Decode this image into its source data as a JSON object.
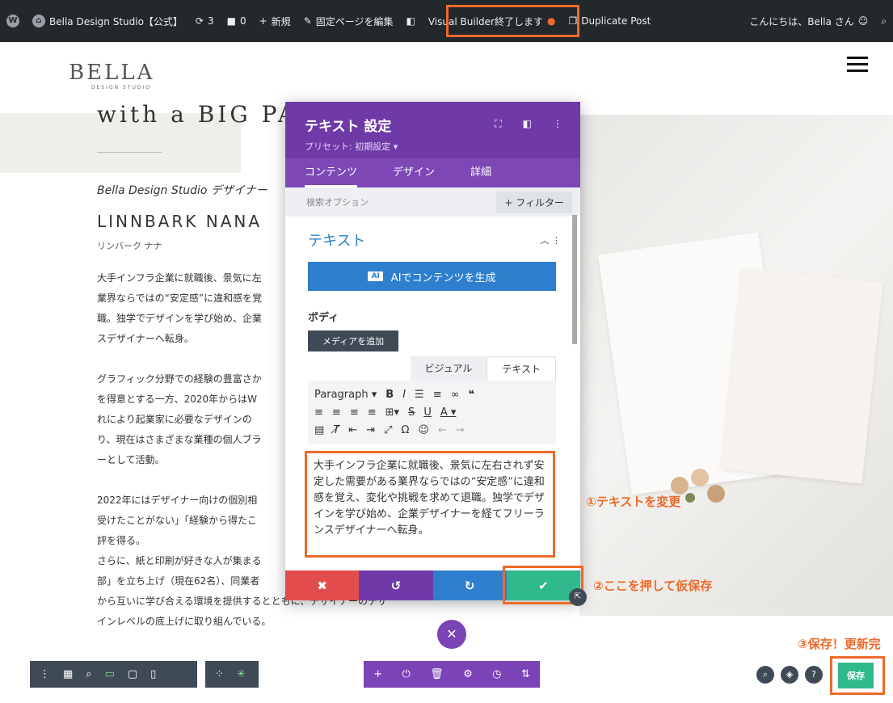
{
  "adminbar": {
    "site_name": "Bella Design Studio【公式】",
    "updates": "3",
    "comments": "0",
    "new": "新規",
    "edit_page": "固定ページを編集",
    "vb_exit": "Visual Builder終了します",
    "duplicate": "Duplicate Post",
    "greeting": "こんにちは、Bella さん"
  },
  "logo": {
    "main": "BELLA",
    "sub": "DESIGN STUDIO"
  },
  "page": {
    "headline": "with a BIG PASSI",
    "studio": "Bella Design Studio デザイナー",
    "name": "LINNBARK NANA",
    "kana": "リンバーク ナナ",
    "para1": [
      "大手インフラ企業に就職後、景気に左",
      "業界ならではの“安定感”に違和感を覚",
      "職。独学でデザインを学び始め、企業",
      "スデザイナーへ転身。"
    ],
    "para2": [
      "グラフィック分野での経験の豊富さか",
      "を得意とする一方、2020年からはW",
      "れにより起業家に必要なデザインの",
      "り、現在はさまざまな業種の個人ブラ",
      "ーとして活動。"
    ],
    "para3": [
      "2022年にはデザイナー向けの個別相",
      "受けたことがない」「経験から得たこ",
      "評を得る。",
      "さらに、紙と印刷が好きな人が集まる",
      "部」を立ち上げ（現在62名）、同業者",
      "から互いに学び合える環境を提供するとともに、デザイナーのデザ",
      "インレベルの底上げに取り組んでいる。"
    ]
  },
  "modal": {
    "title": "テキスト 設定",
    "preset": "プリセット: 初期設定 ▾",
    "tabs": [
      "コンテンツ",
      "デザイン",
      "詳細"
    ],
    "search_placeholder": "検索オプション",
    "filter": "+ フィルター",
    "section": "テキスト",
    "ai_tag": "AI",
    "ai_button": "AIでコンテンツを生成",
    "body_label": "ボディ",
    "media_button": "メディアを追加",
    "editor_tabs": [
      "ビジュアル",
      "テキスト"
    ],
    "format": "Paragraph",
    "text_content": "大手インフラ企業に就職後、景気に左右されず安定した需要がある業界ならではの“安定感”に違和感を覚え、変化や挑戦を求めて退職。独学でデザインを学び始め、企業デザイナーを経てフリーランスデザイナーへ転身。"
  },
  "annotations": {
    "step1": "①テキストを変更",
    "step2": "②ここを押して仮保存",
    "step3": "③保存！更新完"
  },
  "bottom": {
    "save": "保存"
  },
  "colors": {
    "accent": "#ec6a2b",
    "purple": "#6f3aa8",
    "blue": "#2f7fcf",
    "green": "#2fb98c",
    "red": "#e34c4c"
  }
}
